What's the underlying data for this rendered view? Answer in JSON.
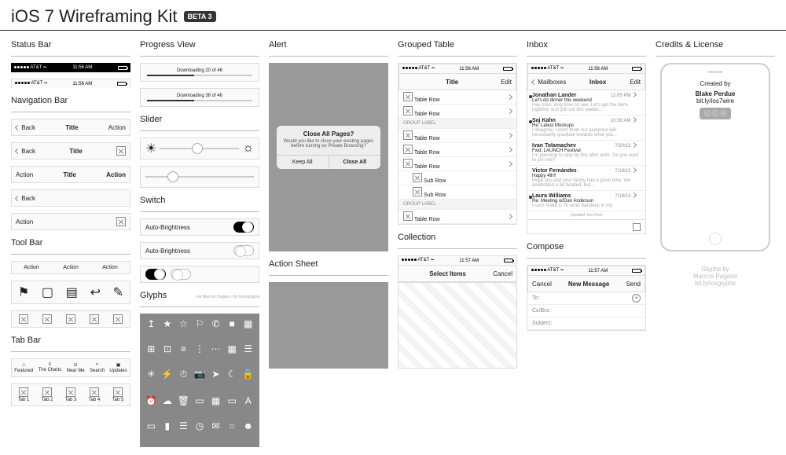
{
  "header": {
    "title": "iOS 7 Wireframing Kit",
    "badge": "BETA 3"
  },
  "statusbar": {
    "label": "Status Bar",
    "carrier": "AT&T",
    "time": "11:56 AM"
  },
  "navbar": {
    "label": "Navigation Bar",
    "back": "Back",
    "title": "Title",
    "action": "Action"
  },
  "toolbar": {
    "label": "Tool Bar",
    "action": "Action"
  },
  "tabbar": {
    "label": "Tab Bar",
    "tabs": [
      "Featured",
      "The Charts",
      "Near Me",
      "Search",
      "Updates"
    ],
    "tabs2": [
      "Tab 1",
      "Tab 2",
      "Tab 3",
      "Tab 4",
      "Tab 5"
    ]
  },
  "progress": {
    "label": "Progress View",
    "t1": "Downloading 20 of 46",
    "t2": "Downloading 38 of 46"
  },
  "slider": {
    "label": "Slider"
  },
  "switch": {
    "label": "Switch",
    "item": "Auto-Brightness"
  },
  "glyphs": {
    "label": "Glyphs",
    "credit": "via Marcos Pagano • bit.ly/iosglyphs"
  },
  "alert": {
    "label": "Alert",
    "title": "Close All Pages?",
    "body": "Would you like to close your existing pages before turning on Private Browsing?",
    "keep": "Keep All",
    "close": "Close All"
  },
  "actionsheet": {
    "label": "Action Sheet"
  },
  "grouped": {
    "label": "Grouped Table",
    "nav_title": "Title",
    "edit": "Edit",
    "row": "Table Row",
    "sub": "Sub Row",
    "group": "Group Label"
  },
  "collection": {
    "label": "Collection",
    "title": "Select Items",
    "cancel": "Cancel"
  },
  "inbox": {
    "label": "Inbox",
    "back": "Mailboxes",
    "title": "Inbox",
    "edit": "Edit",
    "updated": "Updated Just Now",
    "msgs": [
      {
        "n": "Jonathan Lander",
        "t": "12:05 PM",
        "s": "Let's do dinner this weekend",
        "b": "Hey man, long time no see. Let's get the fams together and grill out this weeke...",
        "u": true
      },
      {
        "n": "Saj Kahn",
        "t": "10:30 AM",
        "s": "Re: Latest Mockups",
        "b": "I disagree. I don't think our audience will necessarily gravitate towards what you...",
        "u": true
      },
      {
        "n": "Ivan Tolamachev",
        "t": "7/20/13",
        "s": "Fwd: LAUNCH Festival",
        "b": "I'm planning to stop by this after work. Do you want to join me?",
        "u": false
      },
      {
        "n": "Victor Fernández",
        "t": "7/19/13",
        "s": "Happy 4th!!",
        "b": "Hope you and your family had a great time. We celebrated a bit belated, but...",
        "u": false
      },
      {
        "n": "Laura Williams",
        "t": "7/19/13",
        "s": "Re: Meeting w/Dan Anderson",
        "b": "I can't make it. I'll send Sandeep in my",
        "u": true
      }
    ]
  },
  "compose": {
    "label": "Compose",
    "cancel": "Cancel",
    "title": "New Message",
    "send": "Send",
    "to": "To:",
    "cc": "Cc/Bcc:",
    "subject": "Subject:"
  },
  "credits": {
    "label": "Credits & License",
    "created": "Created by",
    "author": "Blake Perdue",
    "link": "bit.ly/ios7wire",
    "glyphs_by": "Glyphs by",
    "glyphs_author": "Marcos Pagano",
    "glyphs_link": "bit.ly/iosglyphs"
  }
}
